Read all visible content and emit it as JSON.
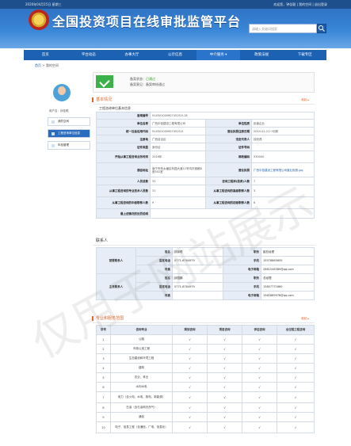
{
  "topbar": {
    "left": "2020年04月15日 星期三",
    "right": "欢迎您，钟佳聪 | 我的空间 | 退出登录"
  },
  "header": {
    "title": "全国投资项目在线审批监管平台",
    "search_placeholder": "请输入关键词搜索"
  },
  "nav": [
    "首页",
    "平台动态",
    "办事大厅",
    "公示信息",
    "中介服务 ▾",
    "政策法规",
    "下载专区"
  ],
  "breadcrumb": {
    "home": "首页",
    "sep": " > ",
    "current": "我的空间"
  },
  "user": {
    "name": "用户名：钟佳聪"
  },
  "left_menu": [
    "我的空间",
    "工程咨询单位信息",
    "年检管理"
  ],
  "status": {
    "label1": "备案状态：",
    "value1": "已通过",
    "label2": "备案意见：",
    "value2": "备案审核通过"
  },
  "section1": {
    "title": "基本情况",
    "more": "收起 ▴"
  },
  "basic": {
    "subhead": "工程咨询单位基本信息",
    "rows": [
      {
        "l1": "备案编号",
        "v1": "91450100090745152I-18"
      },
      {
        "l1": "单位名称",
        "v1": "广西中信建设工程有限公司",
        "l2": "单位性质",
        "v2": "民营企业"
      },
      {
        "l1": "统一社会信用代码",
        "v1": "91450100090745152I",
        "l2": "营业执照注册日期",
        "v2": "2014-02-21～长期"
      },
      {
        "l1": "注册地",
        "v1": "广西自治区",
        "l2": "法定代表人",
        "v2": "钟庆燕"
      },
      {
        "l1": "证件类型",
        "v1": "身份证",
        "l2": "证件号码",
        "v2": ""
      },
      {
        "l1": "开始从事工程咨询业务时间",
        "v1": "2016年",
        "l2": "邮政编码",
        "v2": "530000"
      },
      {
        "l1": "通信地址",
        "v1": "南宁市西乡塘区科园大道11号鸿丰雅都B座502室",
        "l2": "营业执照",
        "v2": "广西中信建设工程有限公司营业执照.jpg"
      },
      {
        "l1": "人员总数",
        "v1": "33",
        "l2": "咨询工程师(投资)人数",
        "v2": "7"
      },
      {
        "l1": "从事工程咨询的专业技术人员数",
        "v1": "31",
        "l2": "从事工程咨询的高级职称人数",
        "v2": "3"
      },
      {
        "l1": "从事工程咨询的中级职称人数",
        "v1": "9",
        "l2": "从事工程咨询的初级职称人数",
        "v2": "6"
      },
      {
        "l1": "最上述情况的处罚说明",
        "v1": ""
      }
    ]
  },
  "section2": {
    "title": "联系人"
  },
  "contacts": {
    "main_label": "首要联系人",
    "second_label": "主责联系人",
    "rows": [
      {
        "l1": "姓名",
        "v1": "钟钟聪",
        "l2": "职务",
        "v2": "副总经理"
      },
      {
        "l1": "固定电话",
        "v1": "0771-6764979",
        "l2": "手机",
        "v2": "15578865655"
      },
      {
        "l1": "传真",
        "v1": "",
        "l2": "电子邮箱",
        "v2": "2661546369@qq.com"
      },
      {
        "l1": "姓名",
        "v1": "钟国鹏",
        "l2": "职务",
        "v2": "总经理"
      },
      {
        "l1": "固定电话",
        "v1": "0771-6764979",
        "l2": "手机",
        "v2": "15807771660"
      },
      {
        "l1": "传真",
        "v1": "",
        "l2": "电子邮箱",
        "v2": "1562889976@qq.com"
      }
    ]
  },
  "section3": {
    "title": "专业和服务范围",
    "more": "收起 ▴"
  },
  "service": {
    "headers": [
      "序号",
      "咨询专业",
      "规划咨询",
      "项目咨询",
      "评估咨询",
      "全过程工程咨询"
    ],
    "rows": [
      {
        "no": "1",
        "name": "公路",
        "c": [
          "√",
          "√",
          "√",
          "√"
        ]
      },
      {
        "no": "2",
        "name": "市政公用工程",
        "c": [
          "√",
          "√",
          "√",
          "√"
        ]
      },
      {
        "no": "3",
        "name": "生态建设和环境工程",
        "c": [
          "√",
          "√",
          "√",
          "√"
        ]
      },
      {
        "no": "4",
        "name": "建筑",
        "c": [
          "√",
          "√",
          "√",
          "√"
        ]
      },
      {
        "no": "5",
        "name": "农业、林业",
        "c": [
          "√",
          "√",
          "√",
          "√"
        ]
      },
      {
        "no": "6",
        "name": "水利水电",
        "c": [
          "√",
          "√",
          "√",
          "√"
        ]
      },
      {
        "no": "7",
        "name": "电力（含火电、水电、核电、新能源）",
        "c": [
          "√",
          "√",
          "√",
          "√"
        ]
      },
      {
        "no": "8",
        "name": "石油（含石油和天然气）",
        "c": [
          "√",
          "√",
          "√",
          "√"
        ]
      },
      {
        "no": "9",
        "name": "通信",
        "c": [
          "√",
          "√",
          "√",
          "√"
        ]
      },
      {
        "no": "10",
        "name": "电子、信息工程（含通信、广电、信息化）",
        "c": [
          "√",
          "√",
          "√",
          "√"
        ]
      }
    ]
  },
  "watermark": "仅用于网站展示"
}
